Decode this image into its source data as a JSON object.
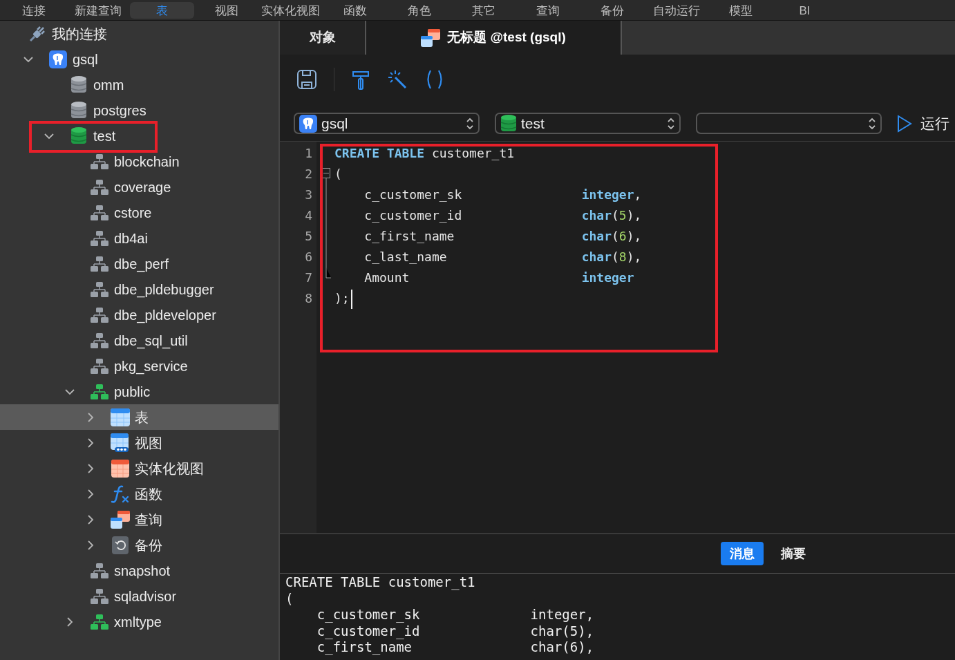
{
  "menu": [
    {
      "label": "连接",
      "selected": false
    },
    {
      "label": "新建查询",
      "selected": false
    },
    {
      "label": "表",
      "selected": true
    },
    {
      "label": "视图",
      "selected": false
    },
    {
      "label": "实体化视图",
      "selected": false
    },
    {
      "label": "函数",
      "selected": false
    },
    {
      "label": "角色",
      "selected": false
    },
    {
      "label": "其它",
      "selected": false
    },
    {
      "label": "查询",
      "selected": false
    },
    {
      "label": "备份",
      "selected": false
    },
    {
      "label": "自动运行",
      "selected": false
    },
    {
      "label": "模型",
      "selected": false
    },
    {
      "label": "BI",
      "selected": false
    }
  ],
  "tree": [
    {
      "label": "我的连接",
      "kind": "group",
      "selected": false,
      "children": [
        {
          "label": "gsql",
          "kind": "connection",
          "expanded": true,
          "selected": false,
          "children": [
            {
              "label": "omm",
              "kind": "database",
              "open": false,
              "selected": false
            },
            {
              "label": "postgres",
              "kind": "database",
              "open": false,
              "selected": false
            },
            {
              "label": "test",
              "kind": "database",
              "open": true,
              "expanded": true,
              "highlighted": true,
              "selected": false,
              "children": [
                {
                  "label": "blockchain",
                  "kind": "schema",
                  "open": false,
                  "selected": false
                },
                {
                  "label": "coverage",
                  "kind": "schema",
                  "open": false,
                  "selected": false
                },
                {
                  "label": "cstore",
                  "kind": "schema",
                  "open": false,
                  "selected": false
                },
                {
                  "label": "db4ai",
                  "kind": "schema",
                  "open": false,
                  "selected": false
                },
                {
                  "label": "dbe_perf",
                  "kind": "schema",
                  "open": false,
                  "selected": false
                },
                {
                  "label": "dbe_pldebugger",
                  "kind": "schema",
                  "open": false,
                  "selected": false
                },
                {
                  "label": "dbe_pldeveloper",
                  "kind": "schema",
                  "open": false,
                  "selected": false
                },
                {
                  "label": "dbe_sql_util",
                  "kind": "schema",
                  "open": false,
                  "selected": false
                },
                {
                  "label": "pkg_service",
                  "kind": "schema",
                  "open": false,
                  "selected": false
                },
                {
                  "label": "public",
                  "kind": "schema",
                  "open": true,
                  "expanded": true,
                  "selected": false,
                  "children": [
                    {
                      "label": "表",
                      "kind": "tables",
                      "expanded": false,
                      "selected": true
                    },
                    {
                      "label": "视图",
                      "kind": "views",
                      "expanded": false,
                      "selected": false
                    },
                    {
                      "label": "实体化视图",
                      "kind": "matviews",
                      "expanded": false,
                      "selected": false
                    },
                    {
                      "label": "函数",
                      "kind": "functions",
                      "expanded": false,
                      "selected": false
                    },
                    {
                      "label": "查询",
                      "kind": "queries",
                      "expanded": false,
                      "selected": false
                    },
                    {
                      "label": "备份",
                      "kind": "backups",
                      "expanded": false,
                      "selected": false
                    }
                  ]
                },
                {
                  "label": "snapshot",
                  "kind": "schema",
                  "open": false,
                  "selected": false
                },
                {
                  "label": "sqladvisor",
                  "kind": "schema",
                  "open": false,
                  "selected": false
                },
                {
                  "label": "xmltype",
                  "kind": "schema",
                  "open": true,
                  "expanded": false,
                  "selected": false
                }
              ]
            }
          ]
        }
      ]
    }
  ],
  "tabs": [
    {
      "label": "对象",
      "kind": "objects",
      "selected": false
    },
    {
      "label": "无标题 @test (gsql)",
      "kind": "query",
      "selected": true
    }
  ],
  "selectors": [
    {
      "kind": "connection",
      "value": "gsql"
    },
    {
      "kind": "database",
      "value": "test"
    },
    {
      "kind": "schema"
    }
  ],
  "run_button": {
    "label": "运行"
  },
  "editor": {
    "highlighted": true,
    "lines": [
      {
        "number": "1",
        "kind": "plain",
        "cursor": false,
        "tokens": [
          {
            "kind": "keyword",
            "text": "CREATE TABLE"
          },
          {
            "kind": "plain",
            "text": " customer_t1"
          }
        ]
      },
      {
        "number": "2",
        "kind": "fold-start",
        "cursor": false,
        "tokens": [
          {
            "kind": "plain",
            "text": "("
          }
        ]
      },
      {
        "number": "3",
        "kind": "fold-inside",
        "cursor": false,
        "tokens": [
          {
            "kind": "plain",
            "text": "    c_customer_sk                "
          },
          {
            "kind": "type",
            "text": "integer"
          },
          {
            "kind": "plain",
            "text": ","
          }
        ]
      },
      {
        "number": "4",
        "kind": "fold-inside",
        "cursor": false,
        "tokens": [
          {
            "kind": "plain",
            "text": "    c_customer_id                "
          },
          {
            "kind": "type",
            "text": "char"
          },
          {
            "kind": "plain",
            "text": "("
          },
          {
            "kind": "number",
            "text": "5"
          },
          {
            "kind": "plain",
            "text": "),"
          }
        ]
      },
      {
        "number": "5",
        "kind": "fold-inside",
        "cursor": false,
        "tokens": [
          {
            "kind": "plain",
            "text": "    c_first_name                 "
          },
          {
            "kind": "type",
            "text": "char"
          },
          {
            "kind": "plain",
            "text": "("
          },
          {
            "kind": "number",
            "text": "6"
          },
          {
            "kind": "plain",
            "text": "),"
          }
        ]
      },
      {
        "number": "6",
        "kind": "fold-inside",
        "cursor": false,
        "tokens": [
          {
            "kind": "plain",
            "text": "    c_last_name                  "
          },
          {
            "kind": "type",
            "text": "char"
          },
          {
            "kind": "plain",
            "text": "("
          },
          {
            "kind": "number",
            "text": "8"
          },
          {
            "kind": "plain",
            "text": "),"
          }
        ]
      },
      {
        "number": "7",
        "kind": "fold-end",
        "cursor": false,
        "tokens": [
          {
            "kind": "plain",
            "text": "    Amount                       "
          },
          {
            "kind": "type",
            "text": "integer"
          }
        ]
      },
      {
        "number": "8",
        "kind": "plain",
        "cursor": true,
        "tokens": [
          {
            "kind": "plain",
            "text": ");"
          }
        ]
      }
    ]
  },
  "result_tabs": [
    {
      "label": "消息",
      "selected": true
    },
    {
      "label": "摘要",
      "selected": false
    }
  ],
  "output": [
    "CREATE TABLE customer_t1",
    "(",
    "    c_customer_sk              integer,",
    "    c_customer_id              char(5),",
    "    c_first_name               char(6),"
  ]
}
